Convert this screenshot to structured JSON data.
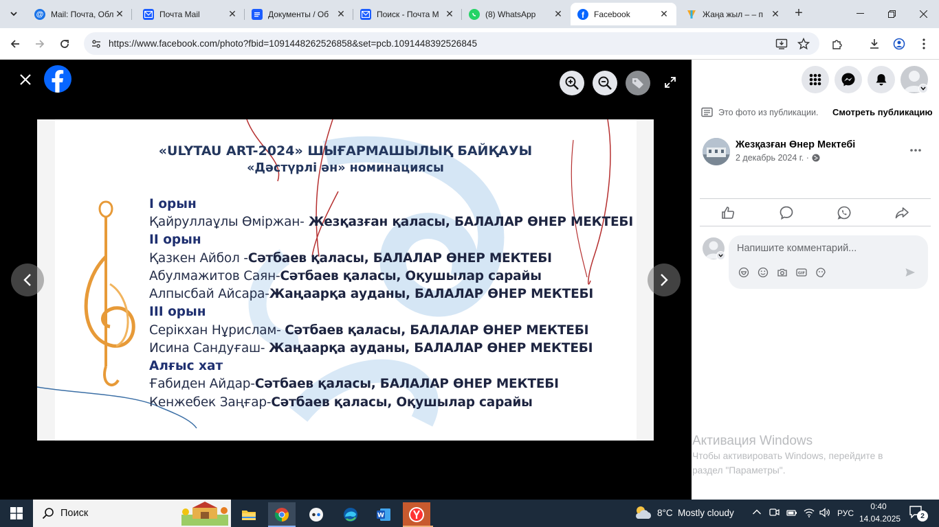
{
  "browser": {
    "tabs": [
      {
        "title": "Mail: Почта, Обл",
        "icon": "mail-at-icon"
      },
      {
        "title": "Почта Mail",
        "icon": "mail-envelope-icon"
      },
      {
        "title": "Документы / Об",
        "icon": "documents-icon"
      },
      {
        "title": "Поиск - Почта М",
        "icon": "mail-envelope-icon"
      },
      {
        "title": "(8) WhatsApp",
        "icon": "whatsapp-icon"
      },
      {
        "title": "Facebook",
        "icon": "facebook-icon"
      },
      {
        "title": "Жаңа жыл – – п",
        "icon": "yandex-icon"
      }
    ],
    "url": "https://www.facebook.com/photo?fbid=1091448262526858&set=pcb.1091448392526845"
  },
  "photo": {
    "title_line1": "«ULYTAU ART-2024» ШЫҒАРМАШЫЛЫҚ БАЙҚАУЫ",
    "title_line2": "«Дәстүрлі ән» номинациясы",
    "place1": "I орын",
    "p1_name": "Қайруллаұлы Өміржан-",
    "p1_org": " Жезқазған қаласы, БАЛАЛАР ӨНЕР МЕКТЕБІ",
    "place2": "II орын",
    "p2a_name": "Қазкен Айбол -",
    "p2a_org": "Сәтбаев қаласы, БАЛАЛАР ӨНЕР МЕКТЕБІ",
    "p2b_name": "Абулмажитов Саян-",
    "p2b_org": "Сәтбаев қаласы, Оқушылар сарайы",
    "p2c_name": "Алпысбай Айсара-",
    "p2c_org": "Жаңаарқа ауданы, БАЛАЛАР ӨНЕР МЕКТЕБІ",
    "place3": "III орын",
    "p3a_name": "Серікхан Нұрислам- ",
    "p3a_org": "Сәтбаев қаласы, БАЛАЛАР ӨНЕР МЕКТЕБІ",
    "p3b_name": "Исина Сандуғаш- ",
    "p3b_org": "Жаңаарқа ауданы, БАЛАЛАР ӨНЕР МЕКТЕБІ",
    "place4": "Алғыс хат",
    "p4a_name": "Ғабиден Айдар-",
    "p4a_org": "Сәтбаев қаласы, БАЛАЛАР ӨНЕР МЕКТЕБІ",
    "p4b_name": "Кенжебек Заңғар-",
    "p4b_org": "Сәтбаев қаласы, Оқушылар сарайы"
  },
  "sidebar": {
    "post_notice": "Это фото из публикации.",
    "view_post": "Смотреть публикацию",
    "author": "Жезқазған Өнер Мектебі",
    "date": "2 декабрь 2024 г. ·",
    "comment_placeholder": "Напишите комментарий...",
    "watermark_title": "Активация Windows",
    "watermark_line1": "Чтобы активировать Windows, перейдите в",
    "watermark_line2": "раздел \"Параметры\"."
  },
  "taskbar": {
    "search": "Поиск",
    "weather": "8°C",
    "weather_desc": "Mostly cloudy",
    "lang": "РУС",
    "time": "0:40",
    "date": "14.04.2025",
    "notif_count": "2"
  },
  "colors": {
    "facebook_blue": "#0866ff",
    "tab_bar": "#dee3ea",
    "taskbar": "#1c2b3b"
  }
}
